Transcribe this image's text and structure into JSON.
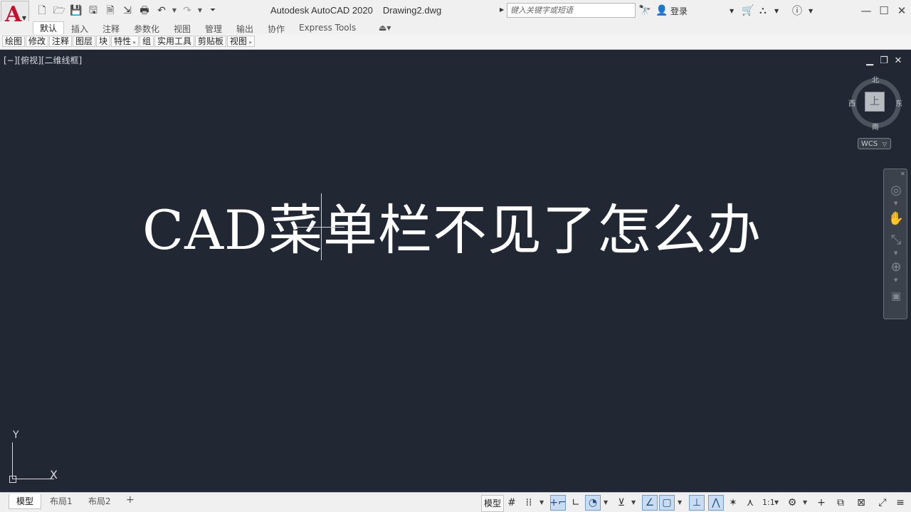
{
  "titlebar": {
    "logo_letter": "A",
    "app_name": "Autodesk AutoCAD 2020",
    "file_name": "Drawing2.dwg",
    "search_placeholder": "键入关键字或短语",
    "login_label": "登录",
    "qat_icons": [
      "new-file-icon",
      "open-folder-icon",
      "save-icon",
      "save-as-icon",
      "publish-icon",
      "import-icon",
      "print-icon",
      "undo-icon",
      "redo-icon",
      "customize-qat-icon"
    ]
  },
  "ribbon": {
    "tabs": [
      "默认",
      "插入",
      "注释",
      "参数化",
      "视图",
      "管理",
      "输出",
      "协作",
      "Express Tools"
    ],
    "panels": [
      "绘图",
      "修改",
      "注释",
      "图层",
      "块",
      "特性",
      "组",
      "实用工具",
      "剪贴板",
      "视图"
    ]
  },
  "viewport": {
    "label": "[−][俯视][二维线框]",
    "drawing_text": "CAD菜单栏不见了怎么办"
  },
  "viewcube": {
    "north": "北",
    "south": "南",
    "east": "东",
    "west": "西",
    "face": "上",
    "wcs_label": "WCS"
  },
  "ucs": {
    "x_label": "X",
    "y_label": "Y"
  },
  "statusbar": {
    "layout_tabs": [
      "模型",
      "布局1",
      "布局2"
    ],
    "add_tab": "+",
    "model_label": "模型",
    "scale": "1:1"
  },
  "colors": {
    "canvas_bg": "#212733",
    "chrome_bg": "#f0f0f0",
    "logo_red": "#c8102e",
    "status_toggle_on": "#c9dcf0"
  }
}
